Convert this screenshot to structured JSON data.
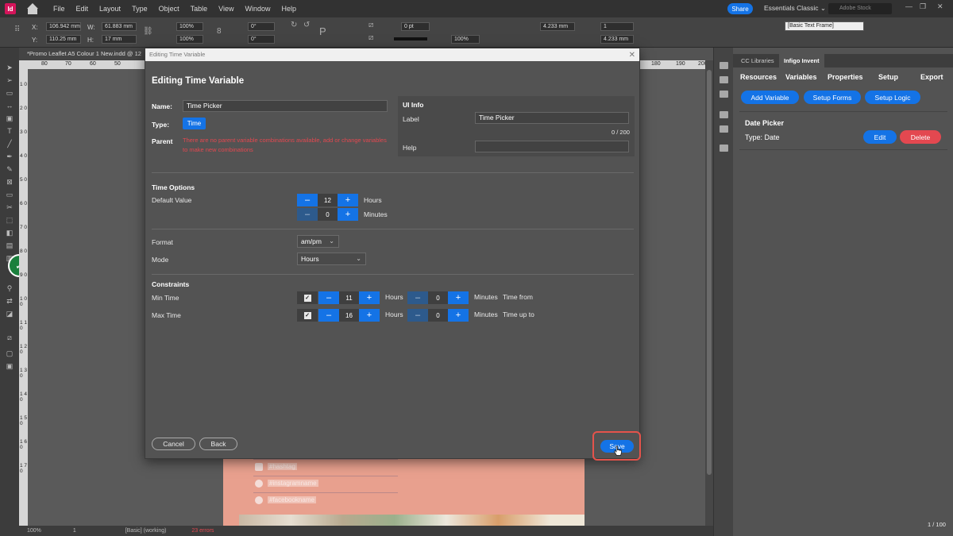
{
  "app": {
    "icon_label": "Id",
    "menu": [
      "File",
      "Edit",
      "Layout",
      "Type",
      "Object",
      "Table",
      "View",
      "Window",
      "Help"
    ],
    "share_label": "Share",
    "workspace": "Essentials Classic ⌄",
    "stock_search_placeholder": "Adobe Stock",
    "doc_tab": "*Promo Leaflet A5 Colour 1 New.indd @ 12",
    "status_zoom": "100%",
    "status_page": "1",
    "status_style": "[Basic] (working)",
    "status_errors": "23 errors",
    "page_counter": "1 / 100"
  },
  "controlbar": {
    "x_label": "X:",
    "x_value": "106.942 mm",
    "y_label": "Y:",
    "y_value": "110.25 mm",
    "w_label": "W:",
    "w_value": "61.883 mm",
    "h_label": "H:",
    "h_value": "17 mm",
    "scale_x": "100%",
    "scale_y": "100%",
    "rotate": "0°",
    "shear": "0°",
    "stroke_pt": "0 pt",
    "opacity": "100%",
    "frame_style": "[Basic Text Frame]",
    "gap_1": "4.233 mm",
    "gap_2": "4.233 mm",
    "columns": "1"
  },
  "ruler": {
    "top": [
      "80",
      "70",
      "60",
      "50",
      "180",
      "190",
      "200"
    ],
    "left": [
      "1 0",
      "2 0",
      "3 0",
      "4 0",
      "5 0",
      "6 0",
      "7 0",
      "8 0",
      "9 0",
      "1 0 0",
      "1 1 0",
      "1 2 0",
      "1 3 0",
      "1 4 0",
      "1 5 0",
      "1 6 0",
      "1 7 0"
    ]
  },
  "page_content": {
    "social": [
      "#hashtag",
      "#instagramname",
      "#facebookname"
    ]
  },
  "panel": {
    "tabs": [
      "CC Libraries",
      "Infigo Invent"
    ],
    "nav": [
      "Resources",
      "Variables",
      "Properties",
      "Setup",
      "Export"
    ],
    "buttons": [
      "Add Variable",
      "Setup Forms",
      "Setup Logic"
    ],
    "variable": {
      "name": "Date Picker",
      "type": "Type: Date",
      "edit": "Edit",
      "delete": "Delete"
    }
  },
  "dialog": {
    "window_title": "Editing Time Variable",
    "title": "Editing Time Variable",
    "name_label": "Name:",
    "name_value": "Time Picker",
    "type_label": "Type:",
    "type_value": "Time",
    "parent_label": "Parent",
    "parent_error": "There are no parent variable combinations available, add or change variables to make new combinations",
    "ui_info": {
      "heading": "UI Info",
      "label_label": "Label",
      "label_value": "Time Picker",
      "counter": "0 / 200",
      "help_label": "Help",
      "help_value": ""
    },
    "time_options": {
      "heading": "Time Options",
      "default_label": "Default Value",
      "hours": "12",
      "hours_unit": "Hours",
      "minutes": "0",
      "minutes_unit": "Minutes"
    },
    "format_label": "Format",
    "format_value": "am/pm",
    "mode_label": "Mode",
    "mode_value": "Hours",
    "constraints": {
      "heading": "Constraints",
      "min": {
        "label": "Min Time",
        "hours": "11",
        "minutes": "0",
        "hours_unit": "Hours",
        "minutes_unit": "Minutes",
        "note": "Time from"
      },
      "max": {
        "label": "Max Time",
        "hours": "16",
        "minutes": "0",
        "hours_unit": "Hours",
        "minutes_unit": "Minutes",
        "note": "Time up to"
      }
    },
    "buttons": {
      "cancel": "Cancel",
      "back": "Back",
      "save": "Save"
    }
  },
  "glyphs": {
    "minus": "–",
    "plus": "+",
    "check": "✓",
    "close": "✕",
    "chevron": "⌄"
  },
  "colors": {
    "accent": "#1473e6",
    "danger": "#e34850",
    "success": "#1a7f3c",
    "highlight": "#e5534b"
  }
}
